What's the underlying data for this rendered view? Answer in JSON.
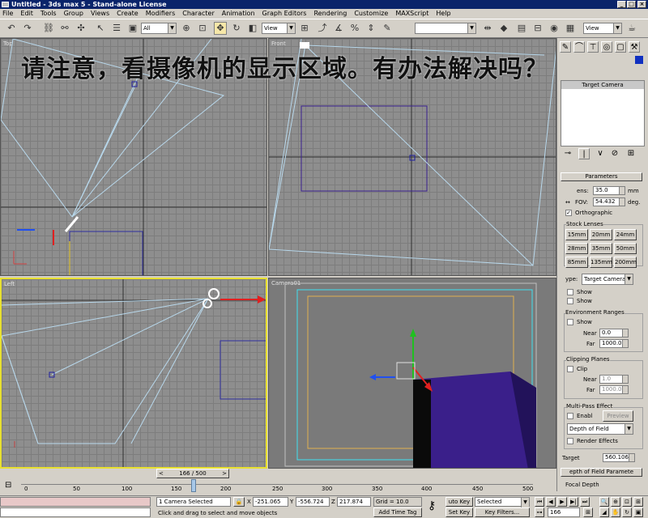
{
  "titlebar": {
    "title": "Untitled - 3ds max 5 - Stand-alone License"
  },
  "menubar": [
    "File",
    "Edit",
    "Tools",
    "Group",
    "Views",
    "Create",
    "Modifiers",
    "Character",
    "Animation",
    "Graph Editors",
    "Rendering",
    "Customize",
    "MAXScript",
    "Help"
  ],
  "toolbar": {
    "selection_filter": "All",
    "ref_coord": "View",
    "named_selection": "",
    "render_type": "View"
  },
  "overlay_text": "请注意，看摄像机的显示区域。有办法解决吗？",
  "viewports": {
    "top": "Top",
    "front": "Front",
    "left": "Left",
    "camera": "Camera01"
  },
  "command_panel": {
    "object_name": "Target Camera",
    "parameters_title": "Parameters",
    "lens_label": "ens:",
    "lens_value": "35.0",
    "lens_unit": "mm",
    "fov_label": "FOV:",
    "fov_value": "54.432",
    "fov_unit": "deg.",
    "orthographic": "Orthographic",
    "stock_lenses_title": "Stock Lenses",
    "stock_lenses": [
      "15mm",
      "20mm",
      "24mm",
      "28mm",
      "35mm",
      "50mm",
      "85mm",
      "135mm",
      "200mm"
    ],
    "type_label": "ype:",
    "type_value": "Target Camera",
    "show_cone": "Show",
    "show_horizon": "Show",
    "env_ranges_title": "Environment Ranges",
    "env_show": "Show",
    "near_label": "Near",
    "env_near": "0.0",
    "far_label": "Far",
    "env_far": "1000.0",
    "clip_title": "Clipping Planes",
    "clip_manual": "Clip",
    "clip_near": "1.0",
    "clip_far": "1000.0",
    "multipass_title": "Multi-Pass Effect",
    "enable": "Enabl",
    "preview": "Preview",
    "effect_value": "Depth of Field",
    "render_effects": "Render Effects",
    "target_label": "Target",
    "target_value": "560.106",
    "dof_params": "epth of Field Paramete",
    "focal_depth": "Focal Depth"
  },
  "timeline": {
    "slider": "166 / 500",
    "ticks": [
      "0",
      "50",
      "100",
      "150",
      "200",
      "250",
      "300",
      "350",
      "400",
      "450",
      "500"
    ]
  },
  "status": {
    "selected": "1 Camera Selected",
    "prompt": "Click and drag to select and move objects",
    "x_label": "X",
    "x": "-251.065",
    "y_label": "Y",
    "y": "-556.724",
    "z_label": "Z",
    "z": "217.874",
    "grid": "Grid = 10.0",
    "add_time_tag": "Add Time Tag",
    "auto_key": "uto Key",
    "auto_key_value": "Selected",
    "set_key": "Set Key",
    "key_filters": "Key Filters...",
    "frame": "166"
  },
  "colors": {
    "title_bar": "#0a246a",
    "active_viewport": "#e8e030",
    "camera_box": "#3a1f8a"
  }
}
